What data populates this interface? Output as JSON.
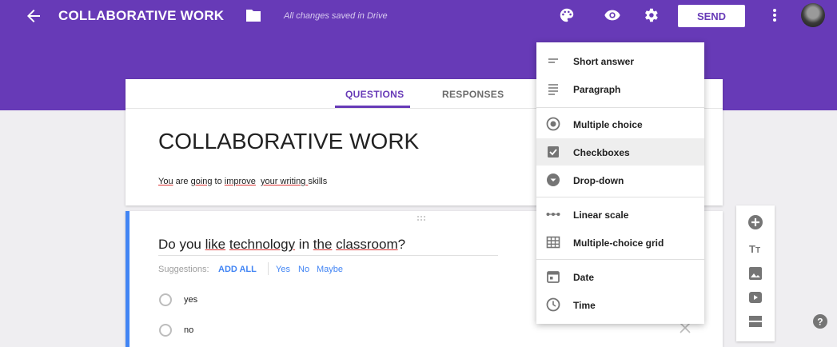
{
  "header": {
    "title": "COLLABORATIVE WORK",
    "saved_status": "All changes saved in Drive",
    "send_label": "SEND",
    "icons": [
      "arrow-back-icon",
      "folder-icon",
      "palette-icon",
      "eye-icon",
      "gear-icon",
      "more-vert-icon"
    ]
  },
  "tabs": {
    "questions": "QUESTIONS",
    "responses": "RESPONSES"
  },
  "form": {
    "title": "COLLABORATIVE WORK",
    "description_parts": [
      "You",
      " are ",
      "going",
      " to ",
      "improve",
      "  ",
      "your",
      " ",
      "writing",
      " ",
      "skills"
    ]
  },
  "question": {
    "text_parts": [
      "Do you ",
      "like",
      " ",
      "technology",
      " in ",
      "the",
      " ",
      "classroom",
      "?"
    ],
    "suggestions_label": "Suggestions:",
    "suggestions_add_all": "ADD ALL",
    "suggestions": [
      "Yes",
      "No",
      "Maybe"
    ],
    "options": [
      "yes",
      "no"
    ]
  },
  "type_menu": {
    "items": [
      {
        "label": "Short answer",
        "icon": "short-answer-icon"
      },
      {
        "label": "Paragraph",
        "icon": "paragraph-icon"
      },
      {
        "label": "Multiple choice",
        "icon": "radio-button-icon"
      },
      {
        "label": "Checkboxes",
        "icon": "checkbox-icon",
        "selected": true
      },
      {
        "label": "Drop-down",
        "icon": "dropdown-icon"
      },
      {
        "label": "Linear scale",
        "icon": "linear-scale-icon"
      },
      {
        "label": "Multiple-choice grid",
        "icon": "grid-icon"
      },
      {
        "label": "Date",
        "icon": "calendar-icon"
      },
      {
        "label": "Time",
        "icon": "clock-icon"
      }
    ]
  },
  "side_toolbar": [
    "add-question-icon",
    "add-title-icon",
    "add-image-icon",
    "add-video-icon",
    "add-section-icon"
  ],
  "colors": {
    "accent": "#673ab7",
    "link": "#4285f4",
    "background": "#efeef1"
  }
}
